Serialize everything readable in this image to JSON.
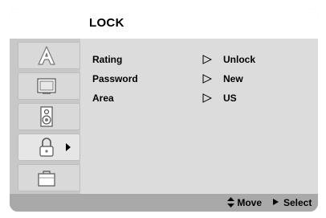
{
  "screen": {
    "title": "LOCK"
  },
  "sidebar": {
    "tabs": [
      {
        "name": "language",
        "icon": "letter-a-icon"
      },
      {
        "name": "display",
        "icon": "tv-screen-icon"
      },
      {
        "name": "audio",
        "icon": "speaker-icon"
      },
      {
        "name": "lock",
        "icon": "padlock-icon",
        "active": true
      },
      {
        "name": "others",
        "icon": "briefcase-icon"
      }
    ]
  },
  "settings": [
    {
      "label": "Rating",
      "value": "Unlock"
    },
    {
      "label": "Password",
      "value": "New"
    },
    {
      "label": "Area",
      "value": "US"
    }
  ],
  "footer": {
    "move_label": "Move",
    "select_label": "Select"
  }
}
